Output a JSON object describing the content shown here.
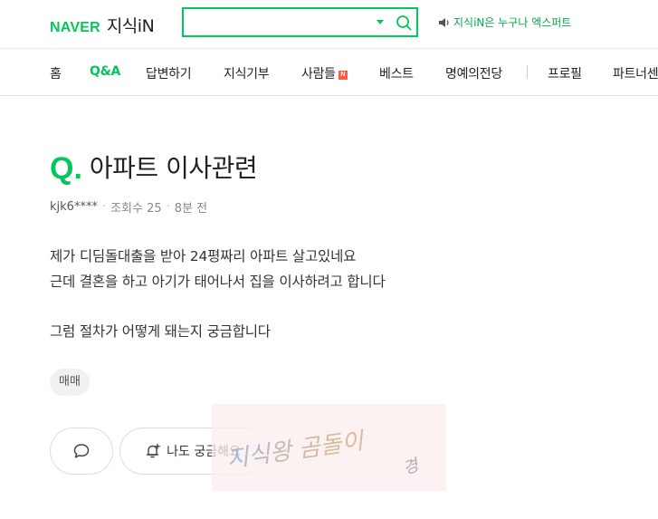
{
  "header": {
    "logo_naver": "NAVER",
    "logo_service": "지식iN",
    "search": {
      "value": "",
      "placeholder": ""
    },
    "promo_text": "지식iN은 누구나 엑스퍼트"
  },
  "nav": {
    "items": [
      {
        "label": "홈"
      },
      {
        "label": "Q&A",
        "active": true
      },
      {
        "label": "답변하기"
      },
      {
        "label": "지식기부"
      },
      {
        "label": "사람들",
        "badge": "N"
      },
      {
        "label": "베스트"
      },
      {
        "label": "명예의전당"
      },
      {
        "label": "프로필"
      },
      {
        "label": "파트너센"
      }
    ]
  },
  "question": {
    "q_mark": "Q.",
    "title": "아파트 이사관련",
    "author": "kjk6****",
    "views": "조회수 25",
    "time": "8분 전",
    "body": [
      "제가 디딤돌대출을 받아 24평짜리 아파트 살고있네요",
      "근데 결혼을 하고 아기가 태어나서 집을 이사하려고 합니다",
      "그럼 절차가 어떻게 돼는지 궁금합니다"
    ],
    "tag": "매매"
  },
  "actions": {
    "curious_label": "나도 궁금해요"
  },
  "watermark": {
    "text": "지식왕 곰돌이",
    "suffix": "경"
  },
  "colors": {
    "brand": "#03c75a",
    "badge": "#ff5b48"
  }
}
